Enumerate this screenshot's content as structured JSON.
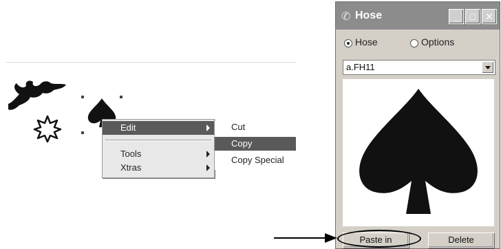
{
  "context_menu": {
    "items": [
      {
        "label": "Edit",
        "has_submenu": true,
        "highlighted": true
      },
      {
        "label": "Tools",
        "has_submenu": true,
        "highlighted": false
      },
      {
        "label": "Xtras",
        "has_submenu": true,
        "highlighted": false
      }
    ],
    "submenu": {
      "items": [
        {
          "label": "Cut",
          "highlighted": false
        },
        {
          "label": "Copy",
          "highlighted": true
        },
        {
          "label": "Copy Special",
          "highlighted": false
        }
      ]
    }
  },
  "hose_window": {
    "title": "Hose",
    "title_icon": "hose-icon",
    "radio_options": [
      {
        "label": "Hose",
        "selected": true
      },
      {
        "label": "Options",
        "selected": false
      }
    ],
    "selected_hose": "a.FH11",
    "preview_icon": "spade-icon",
    "buttons": {
      "paste_in": "Paste in",
      "delete": "Delete"
    },
    "titlebar_buttons": [
      "minimize-icon",
      "maximize-icon",
      "close-icon"
    ]
  },
  "colors": {
    "menu_highlight": "#5a5a5a",
    "window_face": "#d4d0c8",
    "titlebar": "#8c8c8c",
    "artwork": "#111111"
  }
}
